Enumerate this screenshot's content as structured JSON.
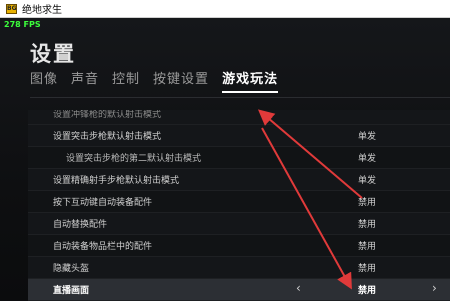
{
  "window": {
    "title": "绝地求生",
    "icon_text": "BG"
  },
  "overlay": {
    "fps": "278 FPS"
  },
  "page": {
    "title": "设置"
  },
  "tabs": [
    {
      "label": "图像"
    },
    {
      "label": "声音"
    },
    {
      "label": "控制"
    },
    {
      "label": "按键设置"
    },
    {
      "label": "游戏玩法"
    }
  ],
  "active_tab": "游戏玩法",
  "rows": [
    {
      "label": "设置突击步枪默认射击模式",
      "value": "单发"
    },
    {
      "label": "设置突击步枪的第二默认射击模式",
      "value": "单发"
    },
    {
      "label": "设置精确射手步枪默认射击模式",
      "value": "单发"
    },
    {
      "label": "按下互动键自动装备配件",
      "value": "禁用"
    },
    {
      "label": "自动替换配件",
      "value": "禁用"
    },
    {
      "label": "自动装备物品栏中的配件",
      "value": "禁用"
    },
    {
      "label": "隐藏头盔",
      "value": "禁用"
    },
    {
      "label": "直播画面",
      "value": "禁用"
    }
  ],
  "icons": {
    "prev": "chevron-left-icon",
    "next": "chevron-right-icon"
  },
  "colors": {
    "background": "#0c0d0f",
    "highlight_row": "#2c2f34",
    "arrow": "#e03a3a",
    "fps": "#3cff3c"
  }
}
